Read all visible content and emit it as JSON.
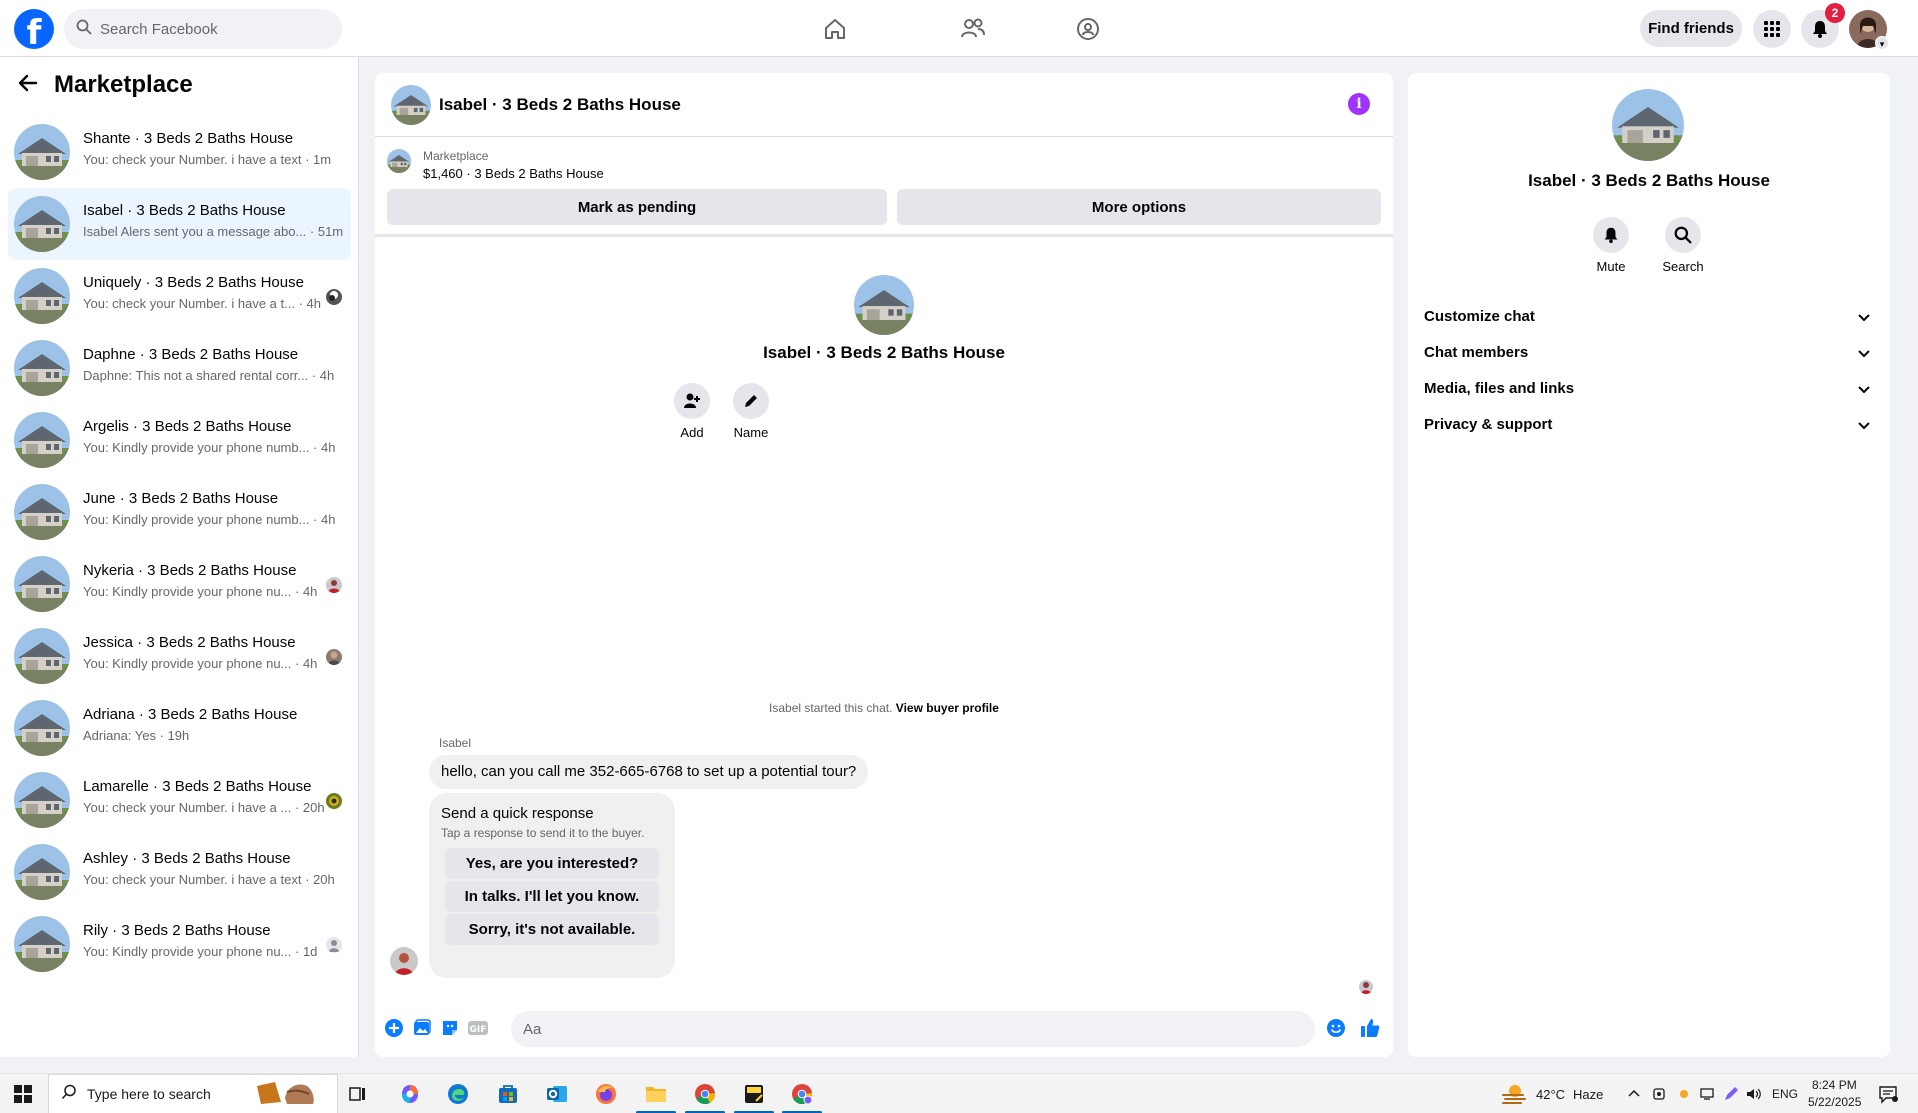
{
  "topbar": {
    "search_placeholder": "Search Facebook",
    "find_friends_label": "Find friends",
    "notification_count": "2",
    "icons": [
      "facebook-logo",
      "search-icon",
      "home-icon",
      "friends-icon",
      "groups-icon",
      "menu-grid-icon",
      "bell-icon",
      "profile-avatar"
    ]
  },
  "sidebar": {
    "title": "Marketplace",
    "conversations": [
      {
        "title": "Shante · 3 Beds 2 Baths House",
        "preview": "You: check your Number. i have a text · 1m"
      },
      {
        "title": "Isabel · 3 Beds 2 Baths House",
        "preview": "Isabel Alers sent you a message abo... · 51m"
      },
      {
        "title": "Uniquely · 3 Beds 2 Baths House",
        "preview": "You: check your Number. i have a t... · 4h"
      },
      {
        "title": "Daphne · 3 Beds 2 Baths House",
        "preview": "Daphne: This not a shared rental corr... · 4h"
      },
      {
        "title": "Argelis · 3 Beds 2 Baths House",
        "preview": "You: Kindly provide your phone numb... · 4h"
      },
      {
        "title": "June · 3 Beds 2 Baths House",
        "preview": "You: Kindly provide your phone numb... · 4h"
      },
      {
        "title": "Nykeria · 3 Beds 2 Baths House",
        "preview": "You: Kindly provide your phone nu... · 4h"
      },
      {
        "title": "Jessica · 3 Beds 2 Baths House",
        "preview": "You: Kindly provide your phone nu... · 4h"
      },
      {
        "title": "Adriana · 3 Beds 2 Baths House",
        "preview": "Adriana: Yes · 19h"
      },
      {
        "title": "Lamarelle · 3 Beds 2 Baths House",
        "preview": "You: check your Number. i have a ... · 20h"
      },
      {
        "title": "Ashley · 3 Beds 2 Baths House",
        "preview": "You: check your Number. i have a text · 20h"
      },
      {
        "title": "Rily · 3 Beds 2 Baths House",
        "preview": "You: Kindly provide your phone nu... · 1d"
      }
    ]
  },
  "chat": {
    "title": "Isabel · 3 Beds 2 Baths House",
    "listing_label": "Marketplace",
    "listing_price": "$1,460 · 3 Beds 2 Baths House",
    "mark_pending_label": "Mark as pending",
    "more_options_label": "More options",
    "intro_title": "Isabel · 3 Beds 2 Baths House",
    "add_label": "Add",
    "name_label": "Name",
    "started_text": "Isabel started this chat.",
    "view_profile_label": "View buyer profile",
    "sender_name": "Isabel",
    "message": "hello, can you call me 352-665-6768 to set up a potential tour?",
    "quick_title": "Send a quick response",
    "quick_subtitle": "Tap a response to send it to the buyer.",
    "quick_responses": [
      "Yes, are you interested?",
      "In talks. I'll let you know.",
      "Sorry, it's not available."
    ],
    "composer_placeholder": "Aa"
  },
  "info_panel": {
    "title": "Isabel · 3 Beds 2 Baths House",
    "mute_label": "Mute",
    "search_label": "Search",
    "sections": [
      "Customize chat",
      "Chat members",
      "Media, files and links",
      "Privacy & support"
    ]
  },
  "taskbar": {
    "search_placeholder": "Type here to search",
    "weather": "42°C",
    "weather_desc": "Haze",
    "language": "ENG",
    "time": "8:24 PM",
    "date": "5/22/2025"
  },
  "colors": {
    "facebook_blue": "#0866ff",
    "messenger_blue": "#0a7cff",
    "info_purple": "#a033ff",
    "badge_red": "#e41e3f",
    "active_row": "#ebf5ff"
  }
}
